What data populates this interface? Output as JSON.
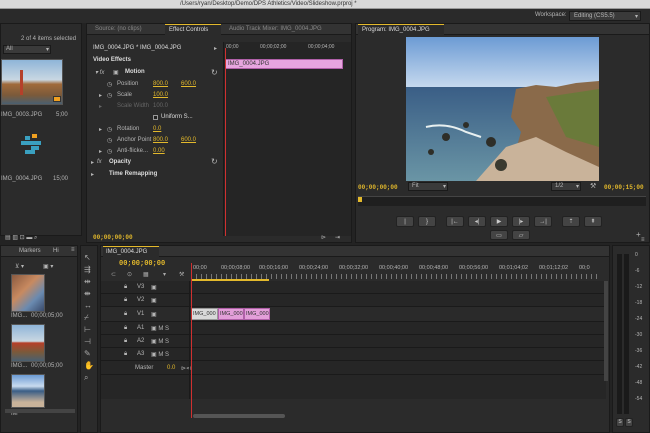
{
  "app": {
    "title": "/Users/ryan/Desktop/Demo/DPS Athletics/Video/Slideshow.prproj *",
    "workspace_label": "Workspace:",
    "workspace_value": "Editing (CS5.5)"
  },
  "project": {
    "items_selected": "2 of 4 items selected",
    "filter": "All",
    "items": [
      {
        "name": "IMG_0003.JPG",
        "duration": "5;00"
      },
      {
        "name": "IMG_0004.JPG",
        "duration": "15;00"
      }
    ]
  },
  "effect_panel": {
    "tabs": [
      "Source: (no clips)",
      "Effect Controls",
      "Audio Track Mixer: IMG_0004.JPG"
    ],
    "clip_path": "IMG_0004.JPG * IMG_0004.JPG",
    "section_label": "Video Effects",
    "motion": "Motion",
    "properties": [
      {
        "name": "Position",
        "v1": "800.0",
        "v2": "600.0"
      },
      {
        "name": "Scale",
        "v1": "100.0",
        "v2": ""
      },
      {
        "name": "Scale Width",
        "v1": "100.0",
        "v2": ""
      },
      {
        "name": "Rotation",
        "v1": "0.0",
        "v2": ""
      },
      {
        "name": "Anchor Point",
        "v1": "800.0",
        "v2": "600.0"
      },
      {
        "name": "Anti-flicke...",
        "v1": "0.00",
        "v2": ""
      }
    ],
    "uniform": "Uniform S...",
    "opacity": "Opacity",
    "time_remap": "Time Remapping",
    "ruler": [
      "00;00",
      "00;00;02;00",
      "00;00;04;00"
    ],
    "clip_label": "IMG_0004.JPG",
    "timecode": "00;00;00;00"
  },
  "program": {
    "title": "Program: IMG_0004.JPG",
    "timecode_left": "00;00;00;00",
    "fit": "Fit",
    "resolution": "1/2",
    "timecode_right": "00;00;15;00"
  },
  "media_browser": {
    "tabs": [
      "Markers",
      "Hi"
    ],
    "items": [
      {
        "name": "IMG...",
        "duration": "00;00;05;00"
      },
      {
        "name": "IMG...",
        "duration": "00;00;05;00"
      },
      {
        "name": "IM",
        "duration": ""
      }
    ]
  },
  "timeline": {
    "tab": "IMG_0004.JPG",
    "timecode": "00;00;00;00",
    "ruler": [
      "00;00",
      "00;00;08;00",
      "00;00;16;00",
      "00;00;24;00",
      "00;00;32;00",
      "00;00;40;00",
      "00;00;48;00",
      "00;00;56;00",
      "00;01;04;02",
      "00;01;12;02",
      "00;0"
    ],
    "tracks": [
      {
        "name": "V3",
        "type": "video"
      },
      {
        "name": "V2",
        "type": "video"
      },
      {
        "name": "V1",
        "type": "video"
      },
      {
        "name": "A1",
        "type": "audio"
      },
      {
        "name": "A2",
        "type": "audio"
      },
      {
        "name": "A3",
        "type": "audio"
      }
    ],
    "master_label": "Master",
    "master_value": "0.0",
    "clips": [
      "IMG_000",
      "IMG_000",
      "IMG_000"
    ]
  },
  "meter": {
    "scale": [
      "0",
      "-6",
      "-12",
      "-18",
      "-24",
      "-30",
      "-36",
      "-42",
      "-48",
      "-54"
    ],
    "labels": [
      "S",
      "S"
    ]
  }
}
